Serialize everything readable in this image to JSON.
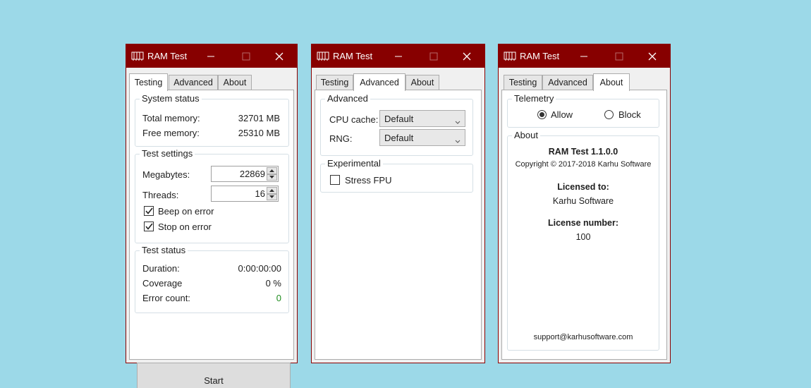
{
  "app": {
    "title": "RAM Test"
  },
  "tabs": [
    "Testing",
    "Advanced",
    "About"
  ],
  "testing": {
    "system_status": {
      "title": "System status",
      "total_memory_label": "Total memory:",
      "total_memory_value": "32701 MB",
      "free_memory_label": "Free memory:",
      "free_memory_value": "25310 MB"
    },
    "test_settings": {
      "title": "Test settings",
      "megabytes_label": "Megabytes:",
      "megabytes_value": "22869",
      "threads_label": "Threads:",
      "threads_value": "16",
      "beep_label": "Beep on error",
      "beep_checked": true,
      "stop_label": "Stop on error",
      "stop_checked": true
    },
    "test_status": {
      "title": "Test status",
      "duration_label": "Duration:",
      "duration_value": "0:00:00:00",
      "coverage_label": "Coverage",
      "coverage_value": "0 %",
      "error_count_label": "Error count:",
      "error_count_value": "0"
    },
    "start_label": "Start"
  },
  "advanced": {
    "group_title": "Advanced",
    "cpu_cache_label": "CPU cache:",
    "cpu_cache_value": "Default",
    "rng_label": "RNG:",
    "rng_value": "Default",
    "experimental_title": "Experimental",
    "stress_fpu_label": "Stress FPU",
    "stress_fpu_checked": false
  },
  "about": {
    "telemetry_title": "Telemetry",
    "allow_label": "Allow",
    "block_label": "Block",
    "telemetry_selected": "Allow",
    "about_title": "About",
    "product": "RAM Test 1.1.0.0",
    "copyright": "Copyright © 2017-2018 Karhu Software",
    "licensed_to_label": "Licensed to:",
    "licensed_to_value": "Karhu Software",
    "license_number_label": "License number:",
    "license_number_value": "100",
    "support_email": "support@karhusoftware.com"
  },
  "colors": {
    "background": "#9cd9e8",
    "titlebar": "#870000",
    "error_count": "#1e8c1e"
  }
}
